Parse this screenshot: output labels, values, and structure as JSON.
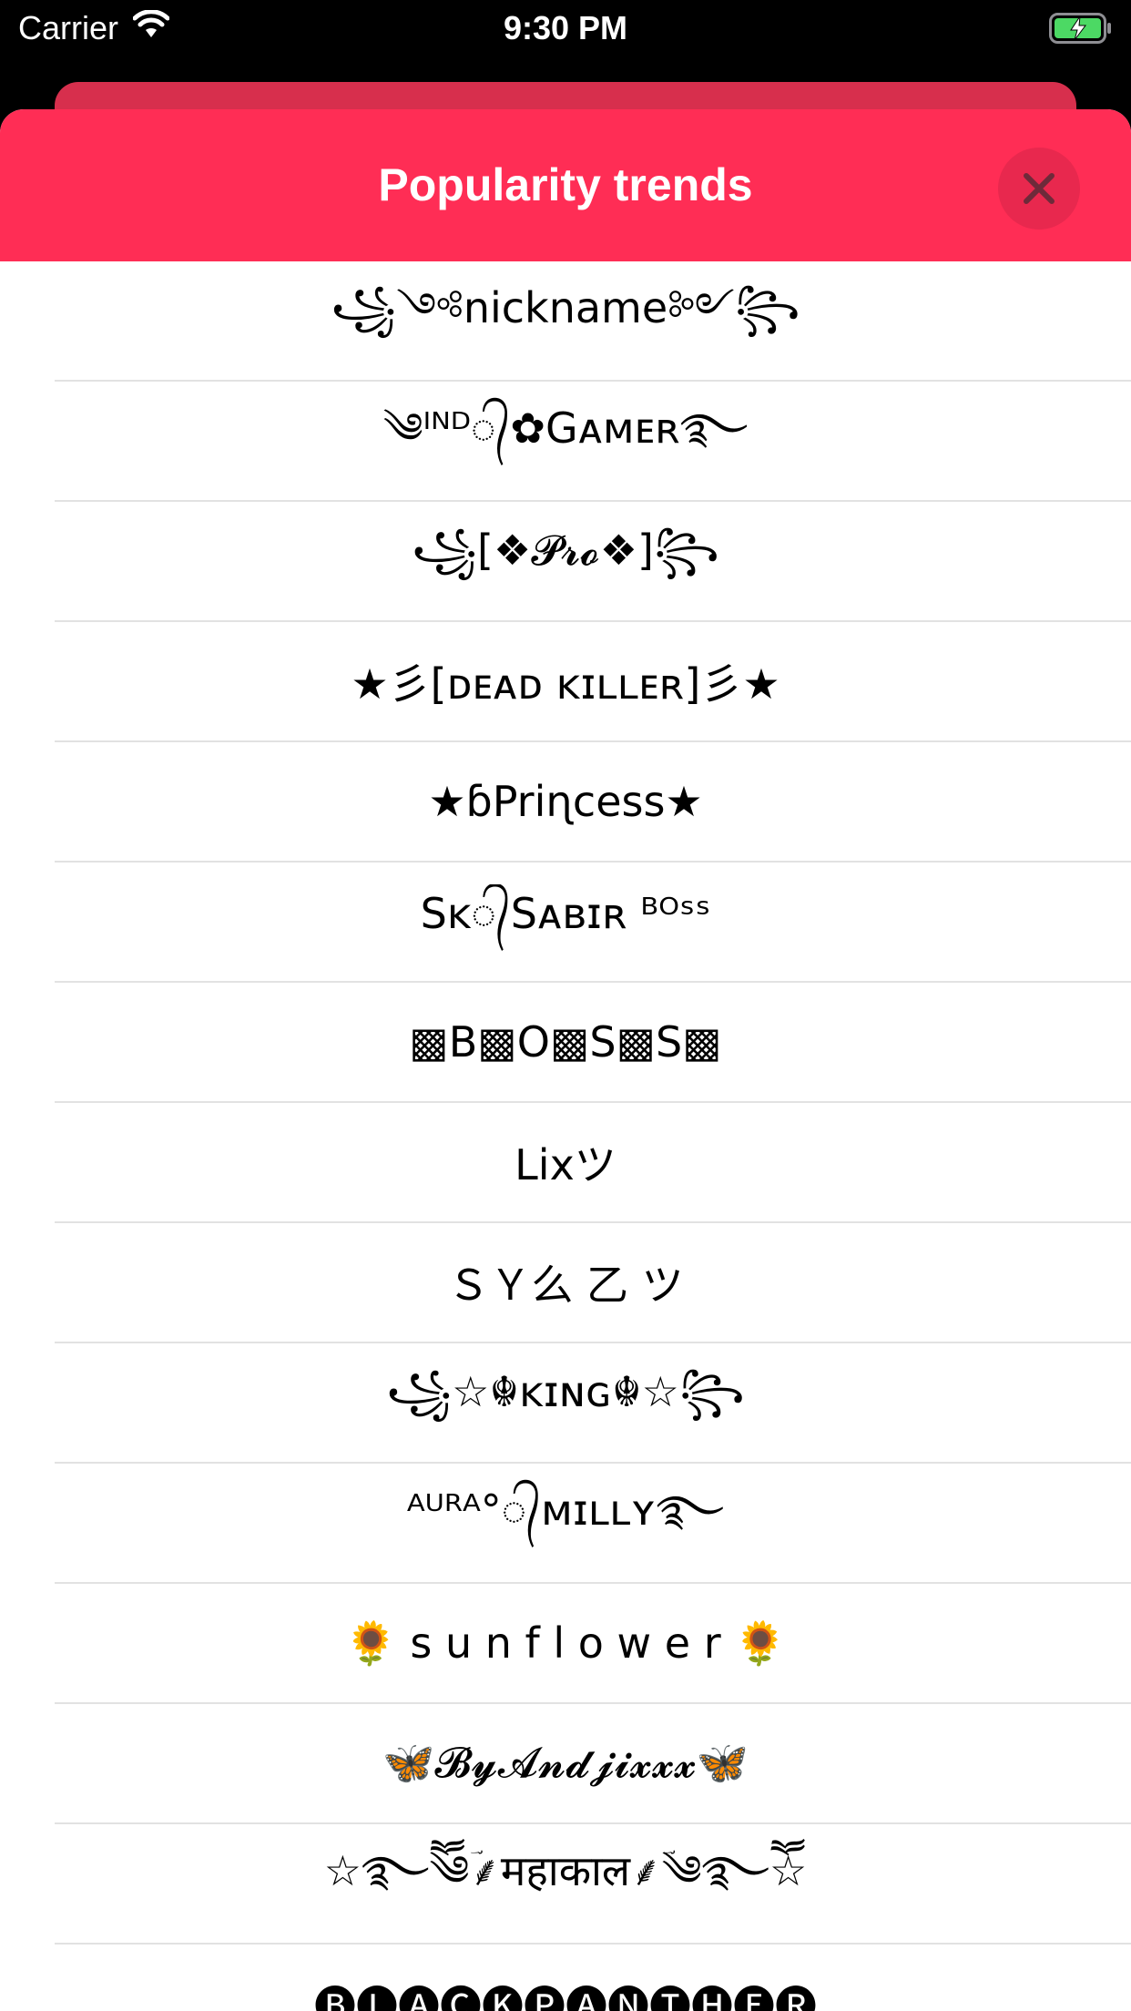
{
  "status_bar": {
    "carrier": "Carrier",
    "time": "9:30 PM",
    "battery_color": "#4cd964"
  },
  "sheet": {
    "title": "Popularity trends",
    "accent_color": "#ff2d55",
    "close_icon": "close-icon"
  },
  "nicknames": [
    "꧁༺nickname༻꧂",
    "༄ᴵᴺᴰ᭄✿Gᴀᴍᴇʀ࿐",
    "꧁[❖𝓟𝓻𝓸❖]꧂",
    "★彡[ᴅᴇᴀᴅ ᴋɪʟʟᴇʀ]彡★",
    "★ɓPriɳcess★",
    "Sᴋ᭄Sᴀʙɪʀ ᴮᴼˢˢ",
    "▩B▩O▩S▩S▩",
    "Lixツ",
    "ＳＹ么 乙 ツ",
    "꧁☆☬ᴋɪɴɢ☬☆꧂",
    "ᴬᵁᴿᴬ°᭄ᴍɪʟʟʏ࿐",
    "🌻 s u n f l o w e r 🌻",
    "🦋𝓑𝔂𝓐𝓷𝓭𝓳𝓲𝔁𝔁𝔁🦋",
    "☆࿐ཽ༄ؔ⸙महाकाल⸙ؔ༄࿐ཽ☆",
    "🅑🅛🅐🅒🅚🅟🅐🅝🅣🅗🅔🅡"
  ]
}
